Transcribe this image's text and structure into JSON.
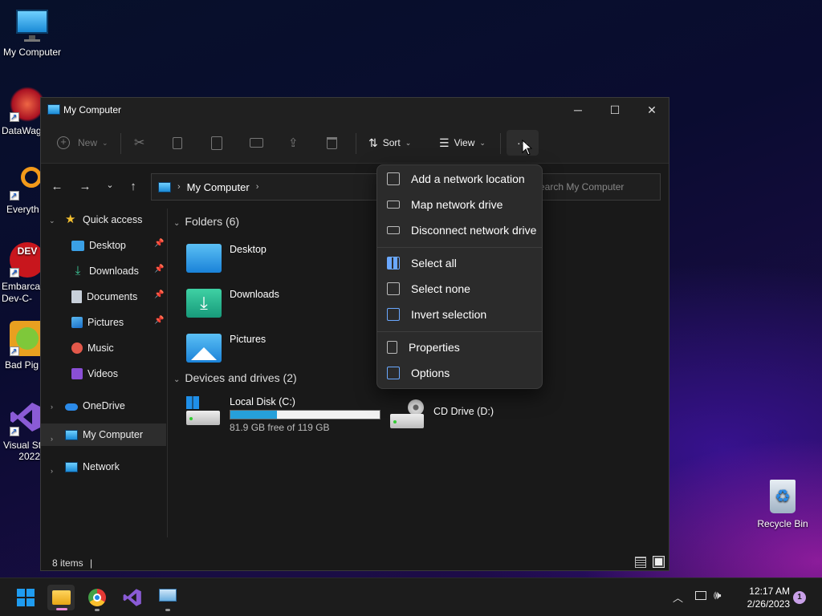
{
  "desktop": {
    "icons": [
      {
        "label": "My Computer"
      },
      {
        "label": "DataWag"
      },
      {
        "label": "Everyth"
      },
      {
        "label": "Embarca\nDev-C-"
      },
      {
        "label": "Bad Pig"
      },
      {
        "label": "Visual St\n2022"
      },
      {
        "label": "Recycle Bin"
      }
    ]
  },
  "window": {
    "title": "My Computer",
    "minimize": "─",
    "maximize": "☐",
    "close": "✕"
  },
  "toolbar": {
    "new": "New",
    "sort": "Sort",
    "view": "View",
    "more": "···"
  },
  "address": {
    "crumb": "My Computer",
    "search_placeholder": "Search My Computer"
  },
  "nav": {
    "quick_access": "Quick access",
    "items": [
      {
        "label": "Desktop"
      },
      {
        "label": "Downloads"
      },
      {
        "label": "Documents"
      },
      {
        "label": "Pictures"
      },
      {
        "label": "Music"
      },
      {
        "label": "Videos"
      }
    ],
    "onedrive": "OneDrive",
    "mycomputer": "My Computer",
    "network": "Network"
  },
  "content": {
    "folders_header": "Folders (6)",
    "folders": [
      {
        "name": "Desktop"
      },
      {
        "name": "Downloads"
      },
      {
        "name": "Pictures"
      }
    ],
    "drives_header": "Devices and drives (2)",
    "drives": [
      {
        "name": "Local Disk (C:)",
        "free": "81.9 GB free of 119 GB",
        "used_fraction": 0.312
      },
      {
        "name": "CD Drive (D:)"
      }
    ]
  },
  "status": {
    "items": "8 items",
    "sep": "|"
  },
  "menu": {
    "items": [
      {
        "label": "Add a network location"
      },
      {
        "label": "Map network drive"
      },
      {
        "label": "Disconnect network drive"
      },
      {
        "label": "Select all"
      },
      {
        "label": "Select none"
      },
      {
        "label": "Invert selection"
      },
      {
        "label": "Properties"
      },
      {
        "label": "Options"
      }
    ]
  },
  "taskbar": {
    "time": "12:17 AM",
    "date": "2/26/2023",
    "notifications": "1"
  },
  "colors": {
    "accent": "#0a84d6",
    "folder_blue": "#3aa0e6",
    "folder_teal": "#24a38f"
  }
}
